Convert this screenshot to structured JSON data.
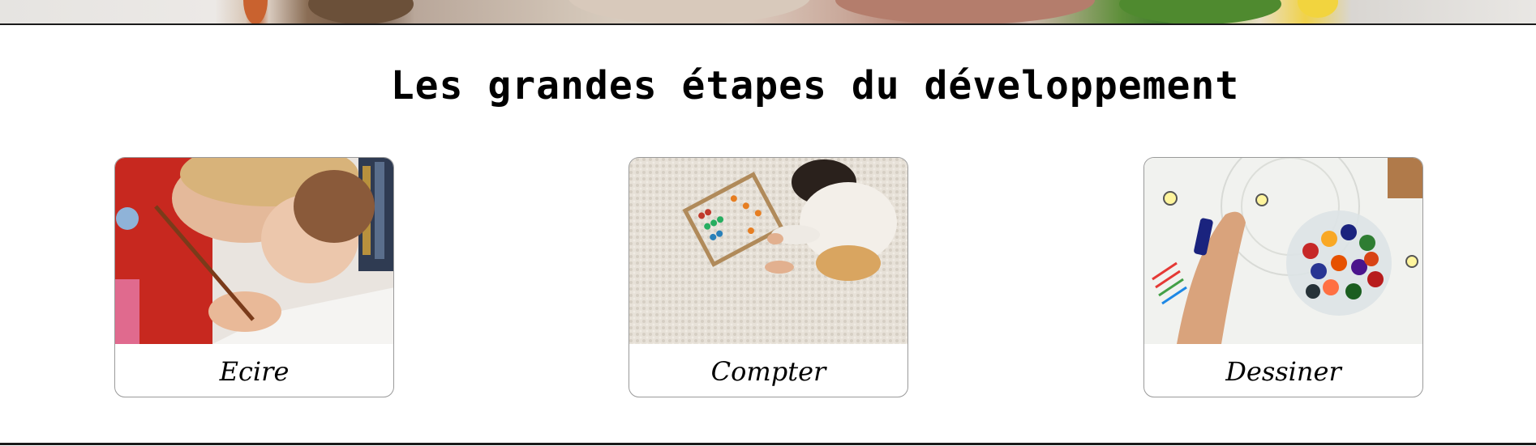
{
  "banner": {
    "image_icon": "plush-toys-photo"
  },
  "section": {
    "title": "Les grandes étapes du développement"
  },
  "cards": [
    {
      "label": "Ecire",
      "image_icon": "children-writing-photo"
    },
    {
      "label": "Compter",
      "image_icon": "child-abacus-photo"
    },
    {
      "label": "Dessiner",
      "image_icon": "crayons-drawing-photo"
    }
  ]
}
